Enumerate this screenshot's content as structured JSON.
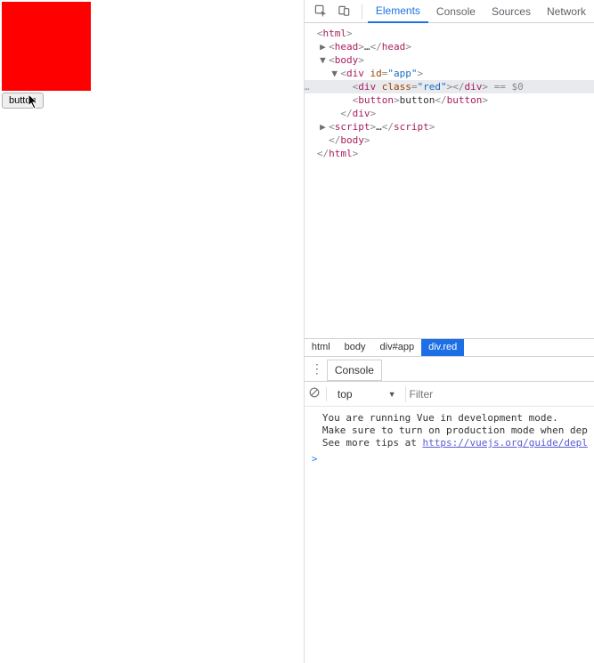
{
  "page": {
    "button_label": "button"
  },
  "devtools": {
    "tabs": [
      "Elements",
      "Console",
      "Sources",
      "Network"
    ],
    "active_tab": "Elements",
    "dom": {
      "lines": [
        {
          "indent": 1,
          "arrow": "",
          "tokens": [
            [
              "punc",
              "<"
            ],
            [
              "tagn",
              "html"
            ],
            [
              "punc",
              ">"
            ]
          ]
        },
        {
          "indent": 2,
          "arrow": "▶",
          "tokens": [
            [
              "punc",
              "<"
            ],
            [
              "tagn",
              "head"
            ],
            [
              "punc",
              ">"
            ],
            [
              "txt",
              "…"
            ],
            [
              "punc",
              "</"
            ],
            [
              "tagn",
              "head"
            ],
            [
              "punc",
              ">"
            ]
          ]
        },
        {
          "indent": 2,
          "arrow": "▼",
          "tokens": [
            [
              "punc",
              "<"
            ],
            [
              "tagn",
              "body"
            ],
            [
              "punc",
              ">"
            ]
          ]
        },
        {
          "indent": 3,
          "arrow": "▼",
          "tokens": [
            [
              "punc",
              "<"
            ],
            [
              "tagn",
              "div "
            ],
            [
              "attrn",
              "id"
            ],
            [
              "punc",
              "="
            ],
            [
              "attrv",
              "\"app\""
            ],
            [
              "punc",
              ">"
            ]
          ]
        },
        {
          "indent": 4,
          "arrow": "",
          "sel": true,
          "tokens": [
            [
              "punc",
              "<"
            ],
            [
              "tagn",
              "div "
            ],
            [
              "attrn",
              "class"
            ],
            [
              "punc",
              "="
            ],
            [
              "attrv",
              "\"red\""
            ],
            [
              "punc",
              "></"
            ],
            [
              "tagn",
              "div"
            ],
            [
              "punc",
              ">"
            ],
            [
              "dollar",
              " == $0"
            ]
          ]
        },
        {
          "indent": 4,
          "arrow": "",
          "tokens": [
            [
              "punc",
              "<"
            ],
            [
              "tagn",
              "button"
            ],
            [
              "punc",
              ">"
            ],
            [
              "txt",
              "button"
            ],
            [
              "punc",
              "</"
            ],
            [
              "tagn",
              "button"
            ],
            [
              "punc",
              ">"
            ]
          ]
        },
        {
          "indent": 3,
          "arrow": "",
          "tokens": [
            [
              "punc",
              "</"
            ],
            [
              "tagn",
              "div"
            ],
            [
              "punc",
              ">"
            ]
          ]
        },
        {
          "indent": 2,
          "arrow": "▶",
          "tokens": [
            [
              "punc",
              "<"
            ],
            [
              "tagn",
              "script"
            ],
            [
              "punc",
              ">"
            ],
            [
              "txt",
              "…"
            ],
            [
              "punc",
              "</"
            ],
            [
              "tagn",
              "script"
            ],
            [
              "punc",
              ">"
            ]
          ]
        },
        {
          "indent": 2,
          "arrow": "",
          "tokens": [
            [
              "punc",
              "</"
            ],
            [
              "tagn",
              "body"
            ],
            [
              "punc",
              ">"
            ]
          ]
        },
        {
          "indent": 1,
          "arrow": "",
          "tokens": [
            [
              "punc",
              "</"
            ],
            [
              "tagn",
              "html"
            ],
            [
              "punc",
              ">"
            ]
          ]
        }
      ]
    },
    "breadcrumb": [
      "html",
      "body",
      "div#app",
      "div.red"
    ],
    "breadcrumb_active": "div.red",
    "console": {
      "tab_label": "Console",
      "context": "top",
      "filter_placeholder": "Filter",
      "messages": [
        "You are running Vue in development mode.",
        "Make sure to turn on production mode when dep",
        "See more tips at "
      ],
      "link": "https://vuejs.org/guide/depl",
      "prompt": ">"
    }
  }
}
